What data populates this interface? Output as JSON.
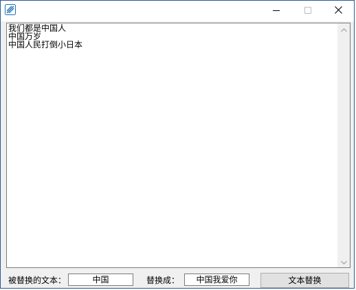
{
  "window": {
    "app_icon": "app-icon",
    "controls": {
      "minimize_icon": "minimize-icon",
      "maximize_icon": "maximize-icon",
      "close_icon": "close-icon"
    }
  },
  "editor": {
    "lines": [
      "我们都是中国人",
      "中国万岁",
      "中国人民打倒小日本"
    ],
    "scrollbar": {
      "up_icon": "scroll-up-arrow-icon",
      "down_icon": "scroll-down-arrow-icon"
    }
  },
  "replace_bar": {
    "find_label": "被替换的文本：",
    "find_value": "中国",
    "replace_label": "替换成：",
    "replace_value": "中国我爱你",
    "button_label": "文本替换"
  },
  "colors": {
    "window_border": "#2b5797",
    "client_bg": "#f0f0f0",
    "button_bg": "#e1e1e1"
  }
}
